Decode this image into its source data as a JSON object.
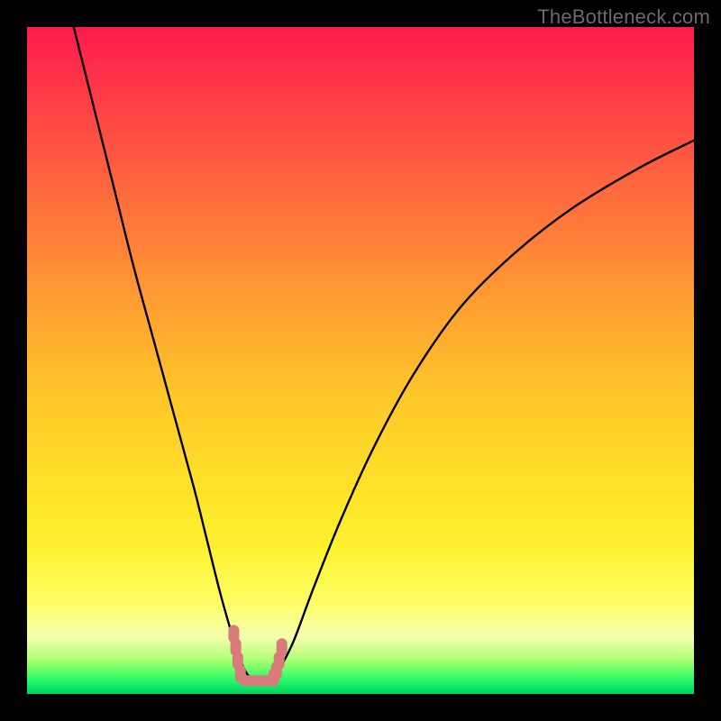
{
  "watermark": {
    "text": "TheBottleneck.com"
  },
  "chart_data": {
    "type": "line",
    "title": "",
    "xlabel": "",
    "ylabel": "",
    "xlim": [
      0,
      100
    ],
    "ylim": [
      0,
      100
    ],
    "series": [
      {
        "name": "bottleneck-curve",
        "x": [
          7,
          10,
          13,
          16,
          19,
          22,
          25,
          27,
          29,
          31,
          32,
          33,
          34,
          35,
          36,
          37,
          38,
          40,
          43,
          47,
          52,
          58,
          65,
          73,
          82,
          92,
          100
        ],
        "values": [
          100,
          88,
          76,
          64,
          53,
          42,
          31,
          23,
          15,
          8,
          5,
          3,
          2,
          2,
          2,
          2.5,
          4,
          8,
          16,
          26,
          37,
          48,
          58,
          66,
          73,
          79,
          83
        ]
      }
    ],
    "highlight": {
      "name": "bottom-cluster",
      "color": "#d97b7b",
      "x": [
        31,
        31.3,
        31.6,
        32,
        33,
        34,
        35,
        36,
        37,
        37.4,
        37.8,
        38.2
      ],
      "values": [
        9,
        7,
        5,
        3,
        2,
        2,
        2,
        2,
        2.5,
        3.5,
        5,
        7
      ]
    },
    "background_gradient": {
      "stops": [
        {
          "pos": 0,
          "color": "#ff1a4d"
        },
        {
          "pos": 50,
          "color": "#ffc629"
        },
        {
          "pos": 88,
          "color": "#feff62"
        },
        {
          "pos": 96,
          "color": "#64ff64"
        },
        {
          "pos": 100,
          "color": "#00d060"
        }
      ]
    }
  }
}
